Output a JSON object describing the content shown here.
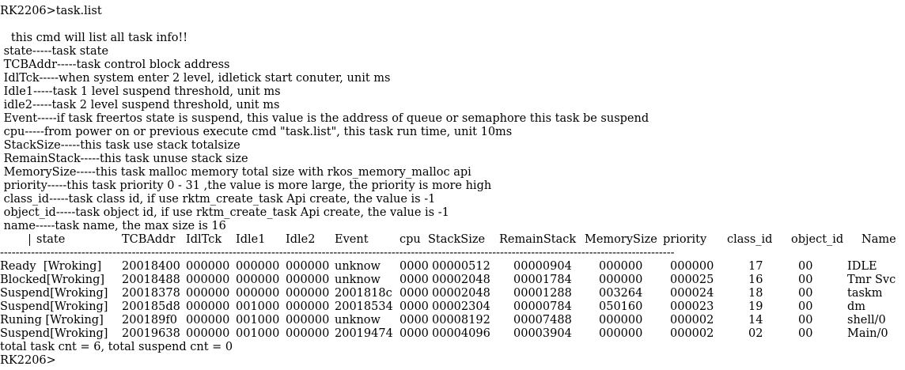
{
  "prompt_command": "RK2206>task.list",
  "help_lines": [
    "   this cmd will list all task info!!",
    " state-----task state",
    " TCBAddr-----task control block address",
    " IdlTck-----when system enter 2 level, idletick start conuter, unit ms",
    " Idle1-----task 1 level suspend threshold, unit ms",
    " idle2-----task 2 level suspend threshold, unit ms",
    " Event-----if task freertos state is suspend, this value is the address of queue or semaphore this task be suspend",
    " cpu-----from power on or previous execute cmd \"task.list\", this task run time, unit 10ms",
    " StackSize-----this task use stack totalsize",
    " RemainStack-----this task unuse stack size",
    " MemorySize-----this task malloc memory total size with rkos_memory_malloc api",
    " priority-----this task priority 0 - 31 ,the value is more large, the priority is more high",
    " class_id-----task class id, if use rktm_create_task Api create, the value is -1",
    " object_id-----task object id, if use rktm_create_task Api create, the value is -1",
    " name-----task name, the max size is 16"
  ],
  "table": {
    "headers": [
      "state",
      "TCBAddr",
      "IdlTck",
      "Idle1",
      "Idle2",
      "Event",
      "cpu",
      "StackSize",
      "RemainStack",
      "MemorySize",
      "priority",
      "class_id",
      "object_id",
      "Name"
    ],
    "separator": "------------------------------------------------------------------------------------------------------------------------------------------------------------------------------",
    "rows": [
      [
        "Ready  [Wroking]",
        "20018400",
        "000000",
        "000000",
        "000000",
        "unknow",
        "0000",
        "00000512",
        "00000904",
        "000000",
        "000000",
        "17",
        "00",
        "IDLE"
      ],
      [
        "Blocked[Wroking]",
        "20018488",
        "000000",
        "000000",
        "000000",
        "unknow",
        "0000",
        "00002048",
        "00001784",
        "000000",
        "000025",
        "16",
        "00",
        "Tmr Svc"
      ],
      [
        "Suspend[Wroking]",
        "20018378",
        "000000",
        "000000",
        "000000",
        "2001818c",
        "0000",
        "00002048",
        "00001288",
        "003264",
        "000024",
        "18",
        "00",
        "taskm"
      ],
      [
        "Suspend[Wroking]",
        "200185d8",
        "000000",
        "001000",
        "000000",
        "20018534",
        "0000",
        "00002304",
        "00000784",
        "050160",
        "000023",
        "19",
        "00",
        "dm"
      ],
      [
        "Runing [Wroking]",
        "200189f0",
        "000000",
        "001000",
        "000000",
        "unknow",
        "0000",
        "00008192",
        "00007488",
        "000000",
        "000002",
        "14",
        "00",
        "shell/0"
      ],
      [
        "Suspend[Wroking]",
        "20019638",
        "000000",
        "001000",
        "000000",
        "20019474",
        "0000",
        "00004096",
        "00003904",
        "000000",
        "000002",
        "02",
        "00",
        "Main/0"
      ]
    ]
  },
  "summary": "total task cnt = 6, total suspend cnt = 0",
  "prompt_end": "RK2206>"
}
